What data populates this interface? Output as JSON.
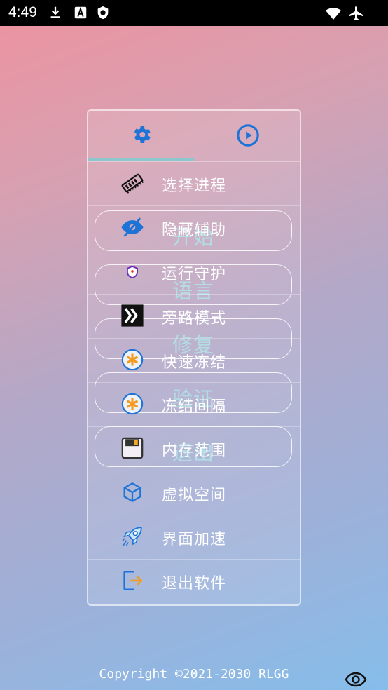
{
  "status_bar": {
    "time": "4:49",
    "left_icons": [
      "download-icon",
      "a-box-icon",
      "shield-app-icon"
    ],
    "right_icons": [
      "wifi-icon",
      "airplane-icon"
    ]
  },
  "background_buttons": [
    {
      "label": "开始"
    },
    {
      "label": "语言"
    },
    {
      "label": "修复"
    },
    {
      "label": "验证"
    },
    {
      "label": "退出"
    }
  ],
  "panel": {
    "tabs": [
      {
        "icon": "gear-icon",
        "active": true
      },
      {
        "icon": "play-circle-icon",
        "active": false
      }
    ],
    "items": [
      {
        "label": "选择进程",
        "icon": "memory-chip-icon"
      },
      {
        "label": "隐藏辅助",
        "icon": "eye-off-icon"
      },
      {
        "label": "运行守护",
        "icon": "shield-icon"
      },
      {
        "label": "旁路模式",
        "icon": "bypass-arrows-icon"
      },
      {
        "label": "快速冻结",
        "icon": "snowflake-icon"
      },
      {
        "label": "冻结间隔",
        "icon": "snowflake-icon"
      },
      {
        "label": "内存范围",
        "icon": "floppy-disk-icon"
      },
      {
        "label": "虚拟空间",
        "icon": "cube-icon"
      },
      {
        "label": "界面加速",
        "icon": "rocket-icon"
      },
      {
        "label": "退出软件",
        "icon": "exit-icon"
      }
    ]
  },
  "footer": {
    "copyright": "Copyright ©2021-2030 RLGG",
    "eye_icon": "eye-icon"
  },
  "colors": {
    "accent_blue": "#1e73d6",
    "tab_indicator": "#8cc7cd",
    "snowflake_orange": "#f39b1f",
    "bg_button_text": "#a9d9e1"
  }
}
